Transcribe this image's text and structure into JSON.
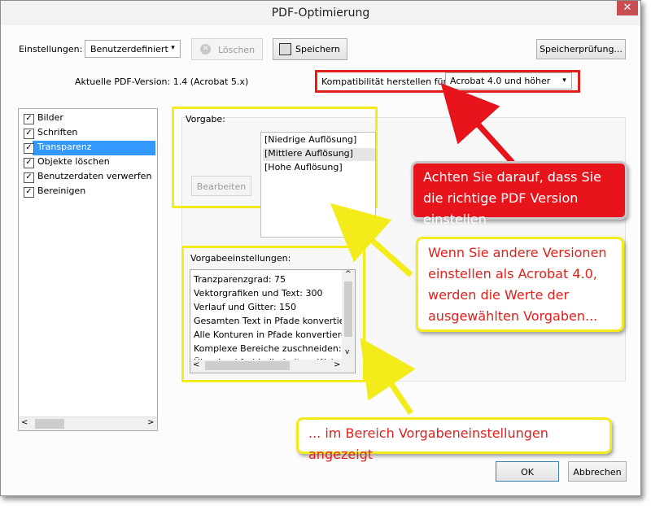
{
  "window": {
    "title": "PDF-Optimierung",
    "close_glyph": "✕"
  },
  "settings": {
    "label": "Einstellungen:",
    "selected": "Benutzerdefiniert",
    "delete_label": "Löschen",
    "save_label": "Speichern",
    "check_label": "Speicherprüfung...",
    "pdf_version": "Aktuelle PDF-Version: 1.4 (Acrobat 5.x)",
    "compat_label": "Kompatibilität herstellen für:",
    "compat_value": "Acrobat 4.0 und höher"
  },
  "sidebar": {
    "items": [
      {
        "label": "Bilder",
        "checked": true
      },
      {
        "label": "Schriften",
        "checked": true
      },
      {
        "label": "Transparenz",
        "checked": true,
        "selected": true
      },
      {
        "label": "Objekte löschen",
        "checked": true
      },
      {
        "label": "Benutzerdaten verwerfen",
        "checked": true
      },
      {
        "label": "Bereinigen",
        "checked": true
      }
    ]
  },
  "preset": {
    "label": "Vorgabe:",
    "edit_label": "Bearbeiten",
    "items": [
      "[Niedrige Auflösung]",
      "[Mittlere Auflösung]",
      "[Hohe Auflösung]"
    ]
  },
  "preset_settings": {
    "label": "Vorgabeeinstellungen:",
    "lines": [
      "Tranzparenzgrad: 75",
      "Vektorgrafiken und Text: 300",
      "Verlauf und Gitter: 150",
      "Gesamten Text in Pfade konvertieren",
      "Alle Konturen in Pfade konvertieren:",
      "Komplexe Bereiche zuschneiden: Wa",
      "Überdruckfarbbeibehalten: Wahr"
    ]
  },
  "footer": {
    "ok_label": "OK",
    "cancel_label": "Abbrechen"
  },
  "callouts": {
    "red": "Achten Sie darauf, dass Sie die richtige PDF Version einstellen",
    "yellow1": "Wenn Sie andere Versionen einstellen als Acrobat 4.0, werden die Werte der ausgewählten Vorgaben...",
    "yellow2": "... im Bereich Vorgabeneinstellungen angezeigt"
  },
  "colors": {
    "callout_red": "#e8141c",
    "highlight_yellow": "#f4ec1a",
    "selection": "#3399ff"
  }
}
